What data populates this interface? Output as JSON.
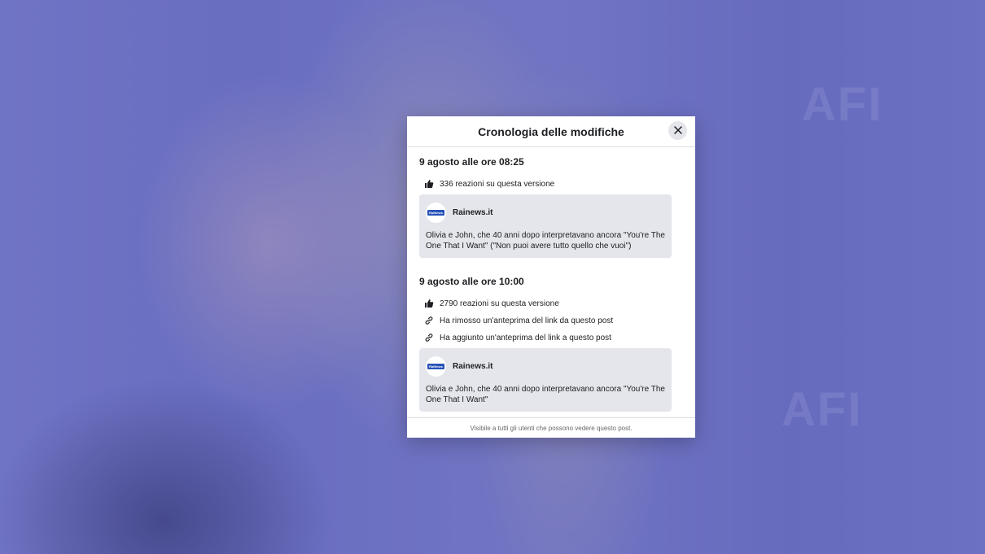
{
  "modal": {
    "title": "Cronologia delle modifiche",
    "footer": "Visibile a tutti gli utenti che possono vedere questo post."
  },
  "versions": [
    {
      "date": "9 agosto alle ore 08:25",
      "reactions": "336 reazioni su questa versione",
      "card": {
        "logo_text": "RaiNews",
        "source": "Rainews.it",
        "text": "Olivia e John, che 40 anni dopo interpretavano ancora \"You're The One That I Want\" (\"Non puoi avere tutto quello che vuoi\")"
      }
    },
    {
      "date": "9 agosto alle ore 10:00",
      "reactions": "2790 reazioni su questa versione",
      "changes": [
        "Ha rimosso un'anteprima del link da questo post",
        "Ha aggiunto un'anteprima del link a questo post"
      ],
      "card": {
        "logo_text": "RaiNews",
        "source": "Rainews.it",
        "text": "Olivia e John, che 40 anni dopo interpretavano ancora \"You're The One That I Want\""
      }
    }
  ],
  "icons": {
    "close": "close-icon",
    "reactions": "thumbs-up-icon",
    "link": "link-icon"
  },
  "colors": {
    "overlay": "#4850be",
    "card_bg": "#e4e6eb",
    "logo_blue": "#2752b8"
  }
}
